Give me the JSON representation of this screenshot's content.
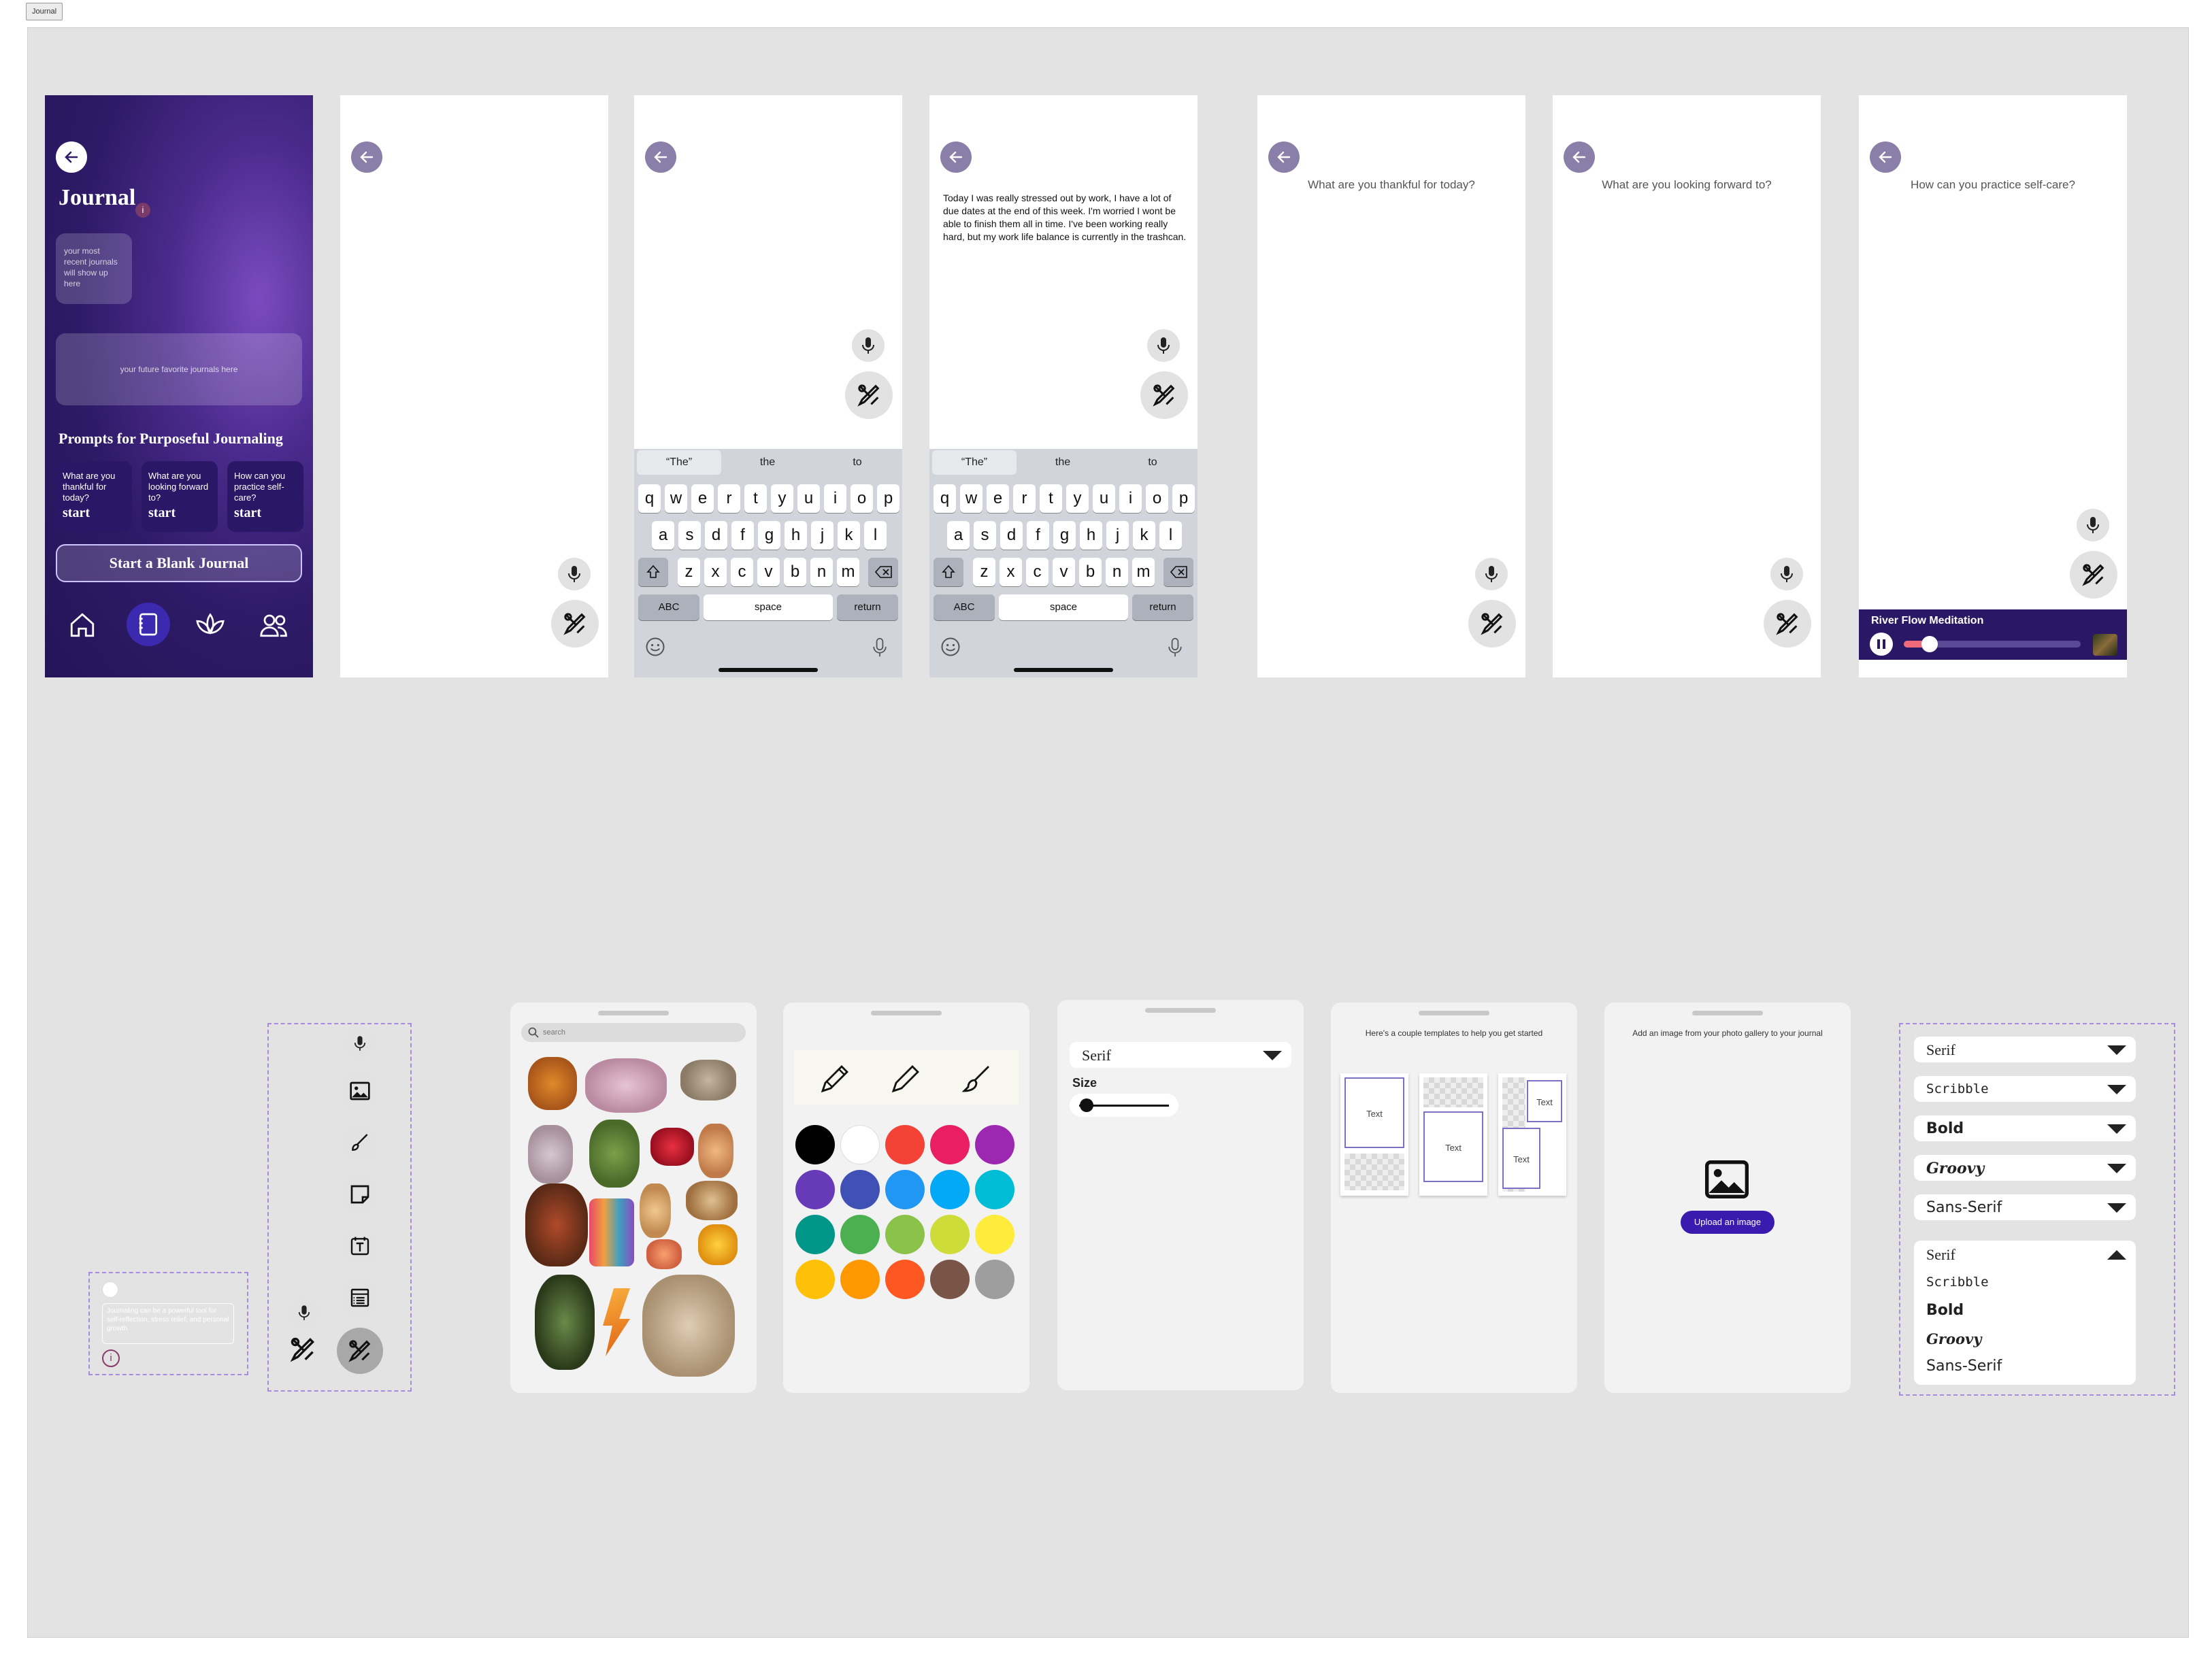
{
  "frame": {
    "label": "Journal"
  },
  "home": {
    "title": "Journal",
    "recent_placeholder": "your most recent journals will show up here",
    "favorites_placeholder": "your future favorite journals here",
    "prompts_heading": "Prompts for Purposeful Journaling",
    "prompts": [
      {
        "text": "What are you thankful for today?",
        "action": "start"
      },
      {
        "text": "What are you looking forward to?",
        "action": "start"
      },
      {
        "text": "How can you practice self-care?",
        "action": "start"
      }
    ],
    "blank_button": "Start a Blank Journal",
    "nav": [
      "home-icon",
      "journal-icon",
      "lotus-icon",
      "people-icon"
    ]
  },
  "keyboard": {
    "suggestions": [
      "“The”",
      "the",
      "to"
    ],
    "row1": [
      "q",
      "w",
      "e",
      "r",
      "t",
      "y",
      "u",
      "i",
      "o",
      "p"
    ],
    "row2": [
      "a",
      "s",
      "d",
      "f",
      "g",
      "h",
      "j",
      "k",
      "l"
    ],
    "row3": [
      "z",
      "x",
      "c",
      "v",
      "b",
      "n",
      "m"
    ],
    "abc": "ABC",
    "space": "space",
    "return": "return"
  },
  "entry_text": "Today I was really stressed out by work, I have a lot of due dates at the end of this week. I'm worried I wont be able to finish them all in time. I've been working really hard, but my work life balance is currently in the trashcan.",
  "prompt_screens": [
    "What are you thankful for today?",
    "What are you looking forward to?",
    "How can you practice self-care?"
  ],
  "player": {
    "title": "River Flow Meditation",
    "progress": 0.1
  },
  "info_card": {
    "text": "Journaling can be a powerful tool for self-reflection, stress relief, and personal growth."
  },
  "sticker_sheet": {
    "search_placeholder": "search"
  },
  "colors": [
    "#000000",
    "#ffffff",
    "#f44336",
    "#e91e63",
    "#9c27b0",
    "#673ab7",
    "#3f51b5",
    "#2196f3",
    "#03a9f4",
    "#00bcd4",
    "#009688",
    "#4caf50",
    "#8bc34a",
    "#cddc39",
    "#ffeb3b",
    "#ffc107",
    "#ff9800",
    "#ff5722",
    "#795548",
    "#9e9e9e"
  ],
  "font_sheet": {
    "font": "Serif",
    "size_label": "Size",
    "size_value": 0.05
  },
  "template_sheet": {
    "heading": "Here's a couple templates to help you get started",
    "box_label": "Text"
  },
  "image_sheet": {
    "heading": "Add an image from your photo gallery to your journal",
    "button": "Upload an image"
  },
  "font_options": [
    "Serif",
    "Scribble",
    "Bold",
    "Groovy",
    "Sans-Serif"
  ]
}
